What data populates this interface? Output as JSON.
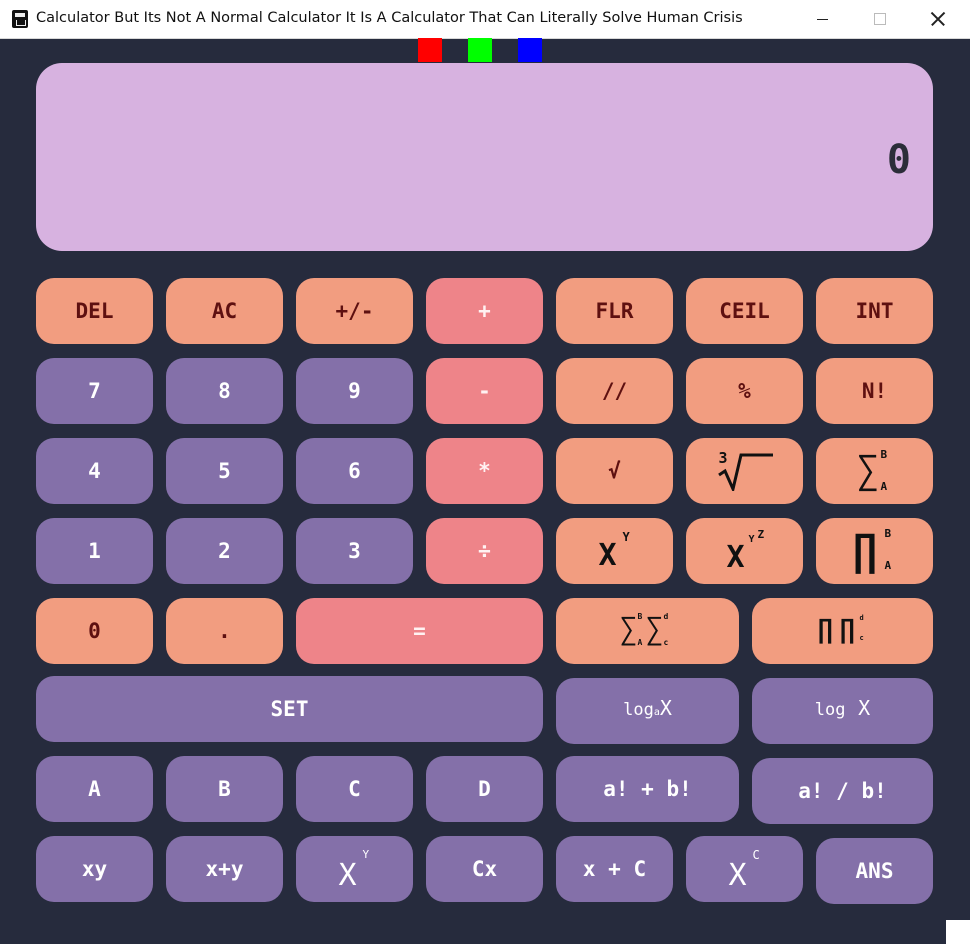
{
  "window": {
    "title": "Calculator But Its Not A Normal Calculator It Is A Calculator That Can Literally Solve Human Crisis"
  },
  "theme_swatches": [
    {
      "name": "red",
      "color": "#ff0000"
    },
    {
      "name": "green",
      "color": "#00ff00"
    },
    {
      "name": "blue",
      "color": "#0000ff"
    }
  ],
  "display": {
    "value": "0"
  },
  "colors": {
    "background": "#262b3d",
    "display": "#d7b2e0",
    "salmon": "#f29d80",
    "pink": "#ee8489",
    "purple": "#8470a9"
  },
  "buttons": {
    "del": "DEL",
    "ac": "AC",
    "negate": "+/-",
    "add": "+",
    "flr": "FLR",
    "ceil": "CEIL",
    "int": "INT",
    "seven": "7",
    "eight": "8",
    "nine": "9",
    "subtract": "-",
    "floordiv": "//",
    "mod": "%",
    "fact": "N!",
    "four": "4",
    "five": "5",
    "six": "6",
    "multiply": "*",
    "sqrt": "√",
    "one": "1",
    "two": "2",
    "three": "3",
    "divide": "÷",
    "zero": "0",
    "dot": ".",
    "equals": "=",
    "set": "SET",
    "a": "A",
    "b": "B",
    "c": "C",
    "d": "D",
    "fact_sum": "a! + b!",
    "fact_div": "a! / b!",
    "xy": "xy",
    "x_plus_y": "x+y",
    "cx": "Cx",
    "x_plus_c": "x + C",
    "ans": "ANS"
  },
  "math_symbols": {
    "x": "X",
    "y": "Y",
    "z": "Z",
    "c": "C",
    "a": "A",
    "b": "B",
    "c_small": "c",
    "d_small": "d",
    "three": "3",
    "sigma": "∑",
    "pi": "∏",
    "log": "log",
    "log_base": "a"
  }
}
